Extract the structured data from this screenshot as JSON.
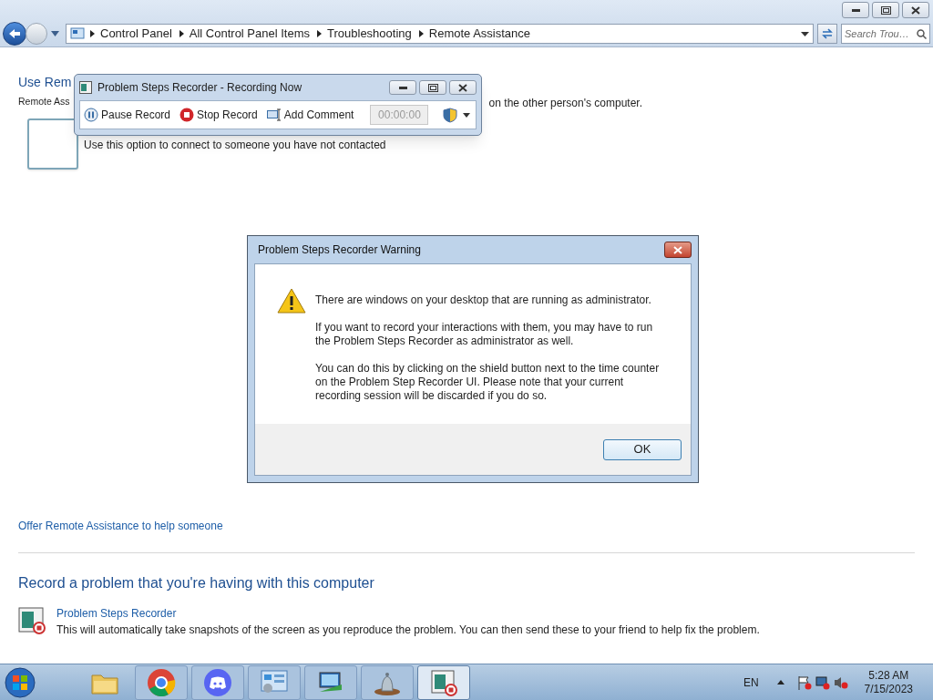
{
  "explorer": {
    "breadcrumb": [
      "Control Panel",
      "All Control Panel Items",
      "Troubleshooting",
      "Remote Assistance"
    ],
    "search": {
      "placeholder": "Search Trou…"
    },
    "heading_visible": "Use Rem",
    "intro_left": "Remote Ass",
    "intro_right": "on the other person's computer.",
    "invite_description": "Use this option to connect to someone you have not contacted",
    "offer_link": "Offer Remote Assistance to help someone",
    "record_heading": "Record a problem that you're having with this computer",
    "psr_link": "Problem Steps Recorder",
    "psr_description": "This will automatically take snapshots of the screen as you reproduce the problem. You can then send these to your friend to help fix the problem."
  },
  "recorder": {
    "title": "Problem Steps Recorder - Recording Now",
    "buttons": [
      {
        "kind": "pause",
        "label": "Pause Record"
      },
      {
        "kind": "stop",
        "label": "Stop Record"
      },
      {
        "kind": "comment",
        "label": "Add Comment"
      }
    ],
    "timer": "00:00:00"
  },
  "dialog": {
    "title": "Problem Steps Recorder Warning",
    "paragraphs": [
      "There are windows on your desktop that are running as administrator.",
      "If you want to record your interactions with them, you may have to run the Problem Steps Recorder as administrator as well.",
      "You can do this by clicking on the shield button next to the time counter on the Problem Step Recorder UI. Please note that your current recording session will be discarded if you do so."
    ],
    "ok": "OK"
  },
  "taskbar": {
    "items": [
      {
        "kind": "folder",
        "selected": false
      },
      {
        "kind": "chrome",
        "selected": false
      },
      {
        "kind": "discord",
        "selected": false
      },
      {
        "kind": "panel",
        "selected": false
      },
      {
        "kind": "network",
        "selected": false
      },
      {
        "kind": "bell",
        "selected": false
      },
      {
        "kind": "recorder",
        "selected": true
      }
    ],
    "language": "EN",
    "time": "5:28 AM",
    "date": "7/15/2023"
  }
}
